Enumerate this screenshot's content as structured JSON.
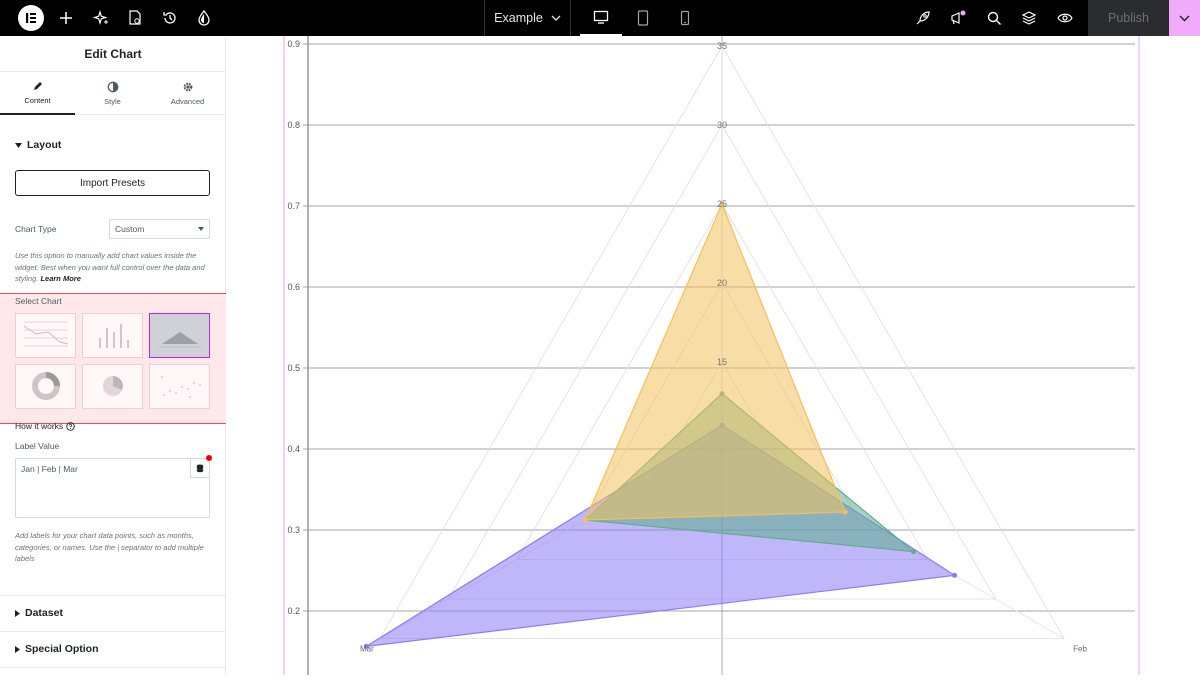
{
  "topbar": {
    "document_name": "Example",
    "publish_label": "Publish",
    "icons": [
      "elementor-logo-icon",
      "add-icon",
      "ai-sparkle-icon",
      "site-settings-icon",
      "history-icon",
      "theme-style-icon"
    ],
    "right_icons": [
      "rocket-icon",
      "notifications-icon",
      "search-icon",
      "structure-icon",
      "preview-icon"
    ],
    "devices": [
      "desktop-icon",
      "tablet-icon",
      "mobile-icon"
    ]
  },
  "panel": {
    "title": "Edit Chart",
    "tabs": [
      {
        "label": "Content",
        "icon": "pencil-icon"
      },
      {
        "label": "Style",
        "icon": "contrast-icon"
      },
      {
        "label": "Advanced",
        "icon": "gear-icon"
      }
    ],
    "layout_label": "Layout",
    "import_presets_label": "Import Presets",
    "chart_type_label": "Chart Type",
    "chart_type_value": "Custom",
    "chart_type_help": "Use this option to manually add chart values inside the widget. Best when you want full control over the data and styling.",
    "learn_more": "Learn More",
    "select_chart_label": "Select Chart",
    "how_it_works": "How it works",
    "label_value_label": "Label Value",
    "label_value": "Jan | Feb | Mar",
    "label_value_help": "Add labels for your chart data points, such as months, categories, or names. Use the | separator to add multiple labels",
    "dataset_label": "Dataset",
    "special_option_label": "Special Option"
  },
  "chart_data": {
    "type": "radar",
    "categories": [
      "Jan",
      "Feb",
      "Mar"
    ],
    "visible_category_labels": [
      "Feb",
      "Mar"
    ],
    "r_ticks": [
      "15",
      "20",
      "25",
      "30",
      "35"
    ],
    "r_range": [
      10,
      35
    ],
    "background_y_ticks": [
      "0.2",
      "0.3",
      "0.4",
      "0.5",
      "0.6",
      "0.7",
      "0.8",
      "0.9"
    ],
    "background_y_range": [
      0.2,
      0.9
    ],
    "grid": true,
    "series": [
      {
        "values": [
          11,
          27,
          36
        ],
        "color": "#8b7cf6"
      },
      {
        "values": [
          13,
          24,
          20
        ],
        "color": "#5fae8c"
      },
      {
        "values": [
          25,
          19,
          20
        ],
        "color": "#f2c15c"
      }
    ]
  }
}
